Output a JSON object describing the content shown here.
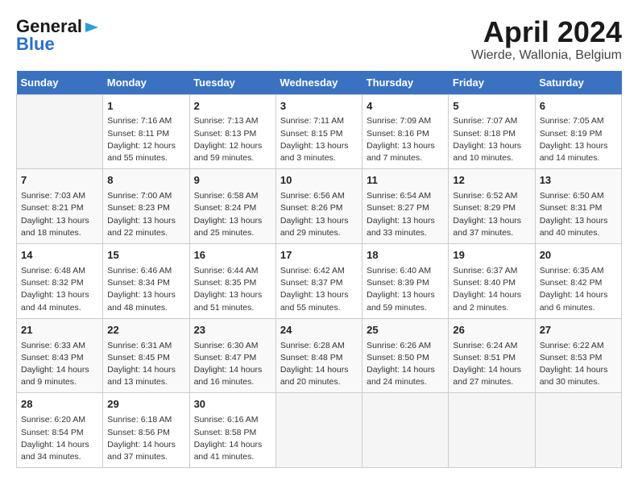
{
  "logo": {
    "line1": "General",
    "line2": "Blue"
  },
  "title": "April 2024",
  "subtitle": "Wierde, Wallonia, Belgium",
  "days_of_week": [
    "Sunday",
    "Monday",
    "Tuesday",
    "Wednesday",
    "Thursday",
    "Friday",
    "Saturday"
  ],
  "weeks": [
    [
      {
        "day": "",
        "info": ""
      },
      {
        "day": "1",
        "info": "Sunrise: 7:16 AM\nSunset: 8:11 PM\nDaylight: 12 hours\nand 55 minutes."
      },
      {
        "day": "2",
        "info": "Sunrise: 7:13 AM\nSunset: 8:13 PM\nDaylight: 12 hours\nand 59 minutes."
      },
      {
        "day": "3",
        "info": "Sunrise: 7:11 AM\nSunset: 8:15 PM\nDaylight: 13 hours\nand 3 minutes."
      },
      {
        "day": "4",
        "info": "Sunrise: 7:09 AM\nSunset: 8:16 PM\nDaylight: 13 hours\nand 7 minutes."
      },
      {
        "day": "5",
        "info": "Sunrise: 7:07 AM\nSunset: 8:18 PM\nDaylight: 13 hours\nand 10 minutes."
      },
      {
        "day": "6",
        "info": "Sunrise: 7:05 AM\nSunset: 8:19 PM\nDaylight: 13 hours\nand 14 minutes."
      }
    ],
    [
      {
        "day": "7",
        "info": "Sunrise: 7:03 AM\nSunset: 8:21 PM\nDaylight: 13 hours\nand 18 minutes."
      },
      {
        "day": "8",
        "info": "Sunrise: 7:00 AM\nSunset: 8:23 PM\nDaylight: 13 hours\nand 22 minutes."
      },
      {
        "day": "9",
        "info": "Sunrise: 6:58 AM\nSunset: 8:24 PM\nDaylight: 13 hours\nand 25 minutes."
      },
      {
        "day": "10",
        "info": "Sunrise: 6:56 AM\nSunset: 8:26 PM\nDaylight: 13 hours\nand 29 minutes."
      },
      {
        "day": "11",
        "info": "Sunrise: 6:54 AM\nSunset: 8:27 PM\nDaylight: 13 hours\nand 33 minutes."
      },
      {
        "day": "12",
        "info": "Sunrise: 6:52 AM\nSunset: 8:29 PM\nDaylight: 13 hours\nand 37 minutes."
      },
      {
        "day": "13",
        "info": "Sunrise: 6:50 AM\nSunset: 8:31 PM\nDaylight: 13 hours\nand 40 minutes."
      }
    ],
    [
      {
        "day": "14",
        "info": "Sunrise: 6:48 AM\nSunset: 8:32 PM\nDaylight: 13 hours\nand 44 minutes."
      },
      {
        "day": "15",
        "info": "Sunrise: 6:46 AM\nSunset: 8:34 PM\nDaylight: 13 hours\nand 48 minutes."
      },
      {
        "day": "16",
        "info": "Sunrise: 6:44 AM\nSunset: 8:35 PM\nDaylight: 13 hours\nand 51 minutes."
      },
      {
        "day": "17",
        "info": "Sunrise: 6:42 AM\nSunset: 8:37 PM\nDaylight: 13 hours\nand 55 minutes."
      },
      {
        "day": "18",
        "info": "Sunrise: 6:40 AM\nSunset: 8:39 PM\nDaylight: 13 hours\nand 59 minutes."
      },
      {
        "day": "19",
        "info": "Sunrise: 6:37 AM\nSunset: 8:40 PM\nDaylight: 14 hours\nand 2 minutes."
      },
      {
        "day": "20",
        "info": "Sunrise: 6:35 AM\nSunset: 8:42 PM\nDaylight: 14 hours\nand 6 minutes."
      }
    ],
    [
      {
        "day": "21",
        "info": "Sunrise: 6:33 AM\nSunset: 8:43 PM\nDaylight: 14 hours\nand 9 minutes."
      },
      {
        "day": "22",
        "info": "Sunrise: 6:31 AM\nSunset: 8:45 PM\nDaylight: 14 hours\nand 13 minutes."
      },
      {
        "day": "23",
        "info": "Sunrise: 6:30 AM\nSunset: 8:47 PM\nDaylight: 14 hours\nand 16 minutes."
      },
      {
        "day": "24",
        "info": "Sunrise: 6:28 AM\nSunset: 8:48 PM\nDaylight: 14 hours\nand 20 minutes."
      },
      {
        "day": "25",
        "info": "Sunrise: 6:26 AM\nSunset: 8:50 PM\nDaylight: 14 hours\nand 24 minutes."
      },
      {
        "day": "26",
        "info": "Sunrise: 6:24 AM\nSunset: 8:51 PM\nDaylight: 14 hours\nand 27 minutes."
      },
      {
        "day": "27",
        "info": "Sunrise: 6:22 AM\nSunset: 8:53 PM\nDaylight: 14 hours\nand 30 minutes."
      }
    ],
    [
      {
        "day": "28",
        "info": "Sunrise: 6:20 AM\nSunset: 8:54 PM\nDaylight: 14 hours\nand 34 minutes."
      },
      {
        "day": "29",
        "info": "Sunrise: 6:18 AM\nSunset: 8:56 PM\nDaylight: 14 hours\nand 37 minutes."
      },
      {
        "day": "30",
        "info": "Sunrise: 6:16 AM\nSunset: 8:58 PM\nDaylight: 14 hours\nand 41 minutes."
      },
      {
        "day": "",
        "info": ""
      },
      {
        "day": "",
        "info": ""
      },
      {
        "day": "",
        "info": ""
      },
      {
        "day": "",
        "info": ""
      }
    ]
  ]
}
